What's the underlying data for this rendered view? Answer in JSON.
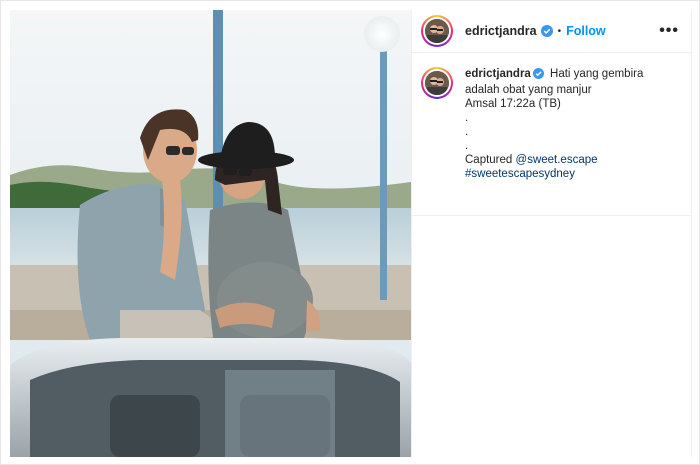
{
  "post": {
    "username": "edrictjandra",
    "separator": "•",
    "follow_label": "Follow",
    "more_label": "•••"
  },
  "caption": {
    "username": "edrictjandra",
    "line1": "Hati yang gembira",
    "line2": "adalah obat yang manjur",
    "line3": "Amsal 17:22a (TB)",
    "dot1": ".",
    "dot2": ".",
    "dot3": ".",
    "captured_label": "Captured",
    "mention": "@sweet.escape",
    "hashtag": "#sweetescapesydney"
  },
  "icons": {
    "verified": "verified-badge-icon",
    "more": "more-options-icon"
  },
  "colors": {
    "link_blue": "#0095f6",
    "verified_blue": "#3897f0",
    "tag_blue": "#00376b"
  }
}
